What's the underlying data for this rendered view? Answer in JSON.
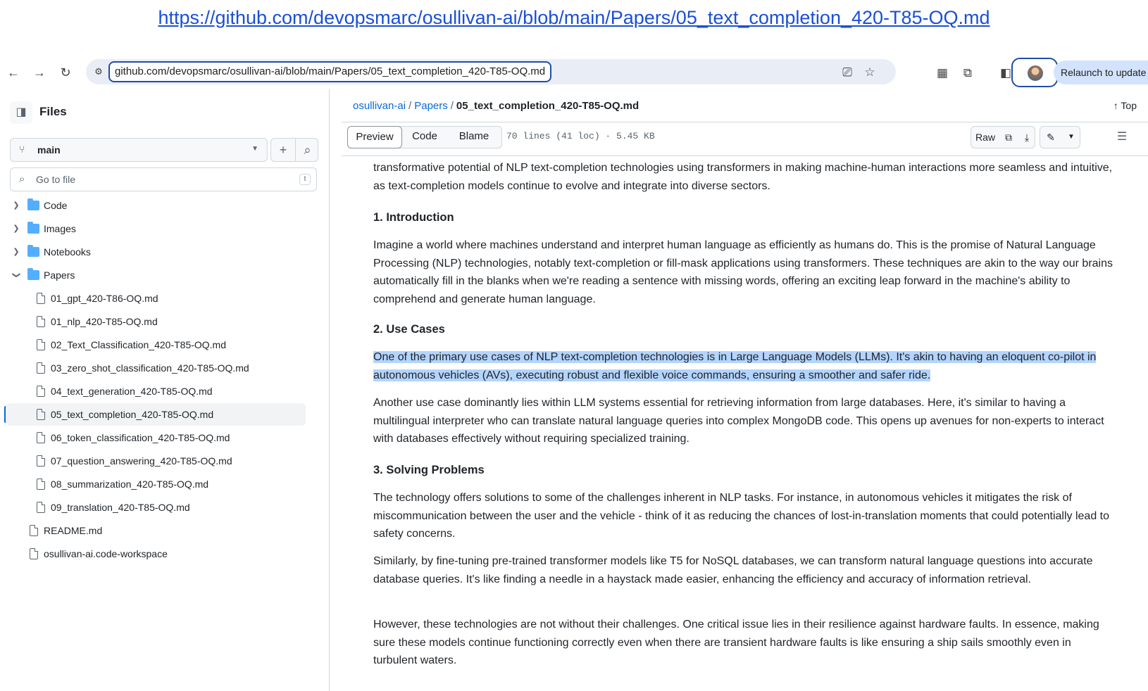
{
  "caption": {
    "url": "https://github.com/devopsmarc/osullivan-ai/blob/main/Papers/05_text_completion_420-T85-OQ.md"
  },
  "browser": {
    "address": "github.com/devopsmarc/osullivan-ai/blob/main/Papers/05_text_completion_420-T85-OQ.md",
    "relaunch_label": "Relaunch to update"
  },
  "sidebar": {
    "title": "Files",
    "branch": "main",
    "goto_placeholder": "Go to file",
    "goto_shortcut": "t",
    "folders": [
      {
        "label": "Code"
      },
      {
        "label": "Images"
      },
      {
        "label": "Notebooks"
      },
      {
        "label": "Papers"
      }
    ],
    "paper_files": [
      {
        "label": "01_gpt_420-T86-OQ.md"
      },
      {
        "label": "01_nlp_420-T85-OQ.md"
      },
      {
        "label": "02_Text_Classification_420-T85-OQ.md"
      },
      {
        "label": "03_zero_shot_classification_420-T85-OQ.md"
      },
      {
        "label": "04_text_generation_420-T85-OQ.md"
      },
      {
        "label": "05_text_completion_420-T85-OQ.md"
      },
      {
        "label": "06_token_classification_420-T85-OQ.md"
      },
      {
        "label": "07_question_answering_420-T85-OQ.md"
      },
      {
        "label": "08_summarization_420-T85-OQ.md"
      },
      {
        "label": "09_translation_420-T85-OQ.md"
      }
    ],
    "root_files": [
      {
        "label": "README.md"
      },
      {
        "label": "osullivan-ai.code-workspace"
      }
    ],
    "selected_file": "05_text_completion_420-T85-OQ.md"
  },
  "main": {
    "breadcrumb": {
      "repo": "osullivan-ai",
      "folder": "Papers",
      "file": "05_text_completion_420-T85-OQ.md"
    },
    "top_label": "Top",
    "tabs": {
      "preview": "Preview",
      "code": "Code",
      "blame": "Blame"
    },
    "meta": "70 lines (41 loc) · 5.45 KB",
    "raw_label": "Raw",
    "content": {
      "intro_tail": "transformative potential of NLP text-completion technologies using transformers in making machine-human interactions more seamless and intuitive, as text-completion models continue to evolve and integrate into diverse sectors.",
      "h1": "1. Introduction",
      "p1": "Imagine a world where machines understand and interpret human language as efficiently as humans do. This is the promise of Natural Language Processing (NLP) technologies, notably text-completion or fill-mask applications using transformers. These techniques are akin to the way our brains automatically fill in the blanks when we're reading a sentence with missing words, offering an exciting leap forward in the machine's ability to comprehend and generate human language.",
      "h2": "2. Use Cases",
      "p2": "One of the primary use cases of NLP text-completion technologies is in Large Language Models (LLMs). It's akin to having an eloquent co-pilot in autonomous vehicles (AVs), executing robust and flexible voice commands, ensuring a smoother and safer ride.",
      "p3": "Another use case dominantly lies within LLM systems essential for retrieving information from large databases. Here, it's similar to having a multilingual interpreter who can translate natural language queries into complex MongoDB code. This opens up avenues for non-experts to interact with databases effectively without requiring specialized training.",
      "h3": "3. Solving Problems",
      "p4": "The technology offers solutions to some of the challenges inherent in NLP tasks. For instance, in autonomous vehicles it mitigates the risk of miscommunication between the user and the vehicle - think of it as reducing the chances of lost-in-translation moments that could potentially lead to safety concerns.",
      "p5": "Similarly, by fine-tuning pre-trained transformer models like T5 for NoSQL databases, we can transform natural language questions into accurate database queries. It's like finding a needle in a haystack made easier, enhancing the efficiency and accuracy of information retrieval.",
      "p6": "However, these technologies are not without their challenges. One critical issue lies in their resilience against hardware faults. In essence, making sure these models continue functioning correctly even when there are transient hardware faults is like ensuring a ship sails smoothly even in turbulent waters."
    }
  },
  "colors": {
    "link": "#0969da",
    "highlight": "#b3d4fd",
    "folder": "#54aeff",
    "caption_link": "#1a4fd6"
  }
}
